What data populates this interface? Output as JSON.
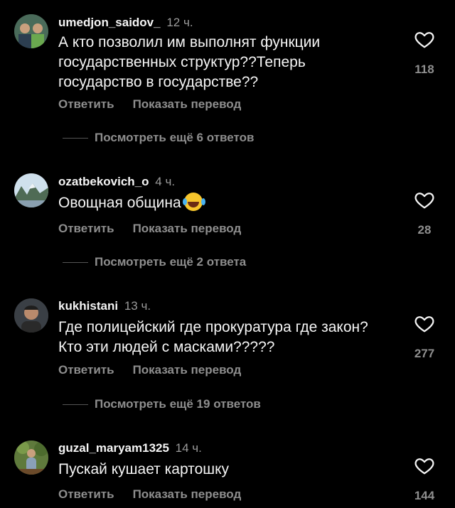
{
  "comments": [
    {
      "username": "umedjon_saidov_",
      "time": "12 ч.",
      "text": "А кто позволил им выполнят функции государственных структур??Теперь государство в государстве??",
      "reply_label": "Ответить",
      "translate_label": "Показать перевод",
      "likes": "118",
      "view_replies": "Посмотреть ещё 6 ответов"
    },
    {
      "username": "ozatbekovich_o",
      "time": "4 ч.",
      "text": "Овощная община",
      "emoji": "face-with-tears-of-joy",
      "reply_label": "Ответить",
      "translate_label": "Показать перевод",
      "likes": "28",
      "view_replies": "Посмотреть ещё 2 ответа"
    },
    {
      "username": "kukhistani",
      "time": "13 ч.",
      "text": "Где полицейский где прокуратура где закон? Кто эти людей с масками?????",
      "reply_label": "Ответить",
      "translate_label": "Показать перевод",
      "likes": "277",
      "view_replies": "Посмотреть ещё 19 ответов"
    },
    {
      "username": "guzal_maryam1325",
      "time": "14 ч.",
      "text": "Пускай кушает картошку",
      "reply_label": "Ответить",
      "translate_label": "Показать перевод",
      "likes": "144"
    }
  ],
  "icons": {
    "like": "heart-outline-icon"
  },
  "colors": {
    "background": "#000000",
    "text": "#f5f5f5",
    "muted": "#8e8e8e"
  }
}
